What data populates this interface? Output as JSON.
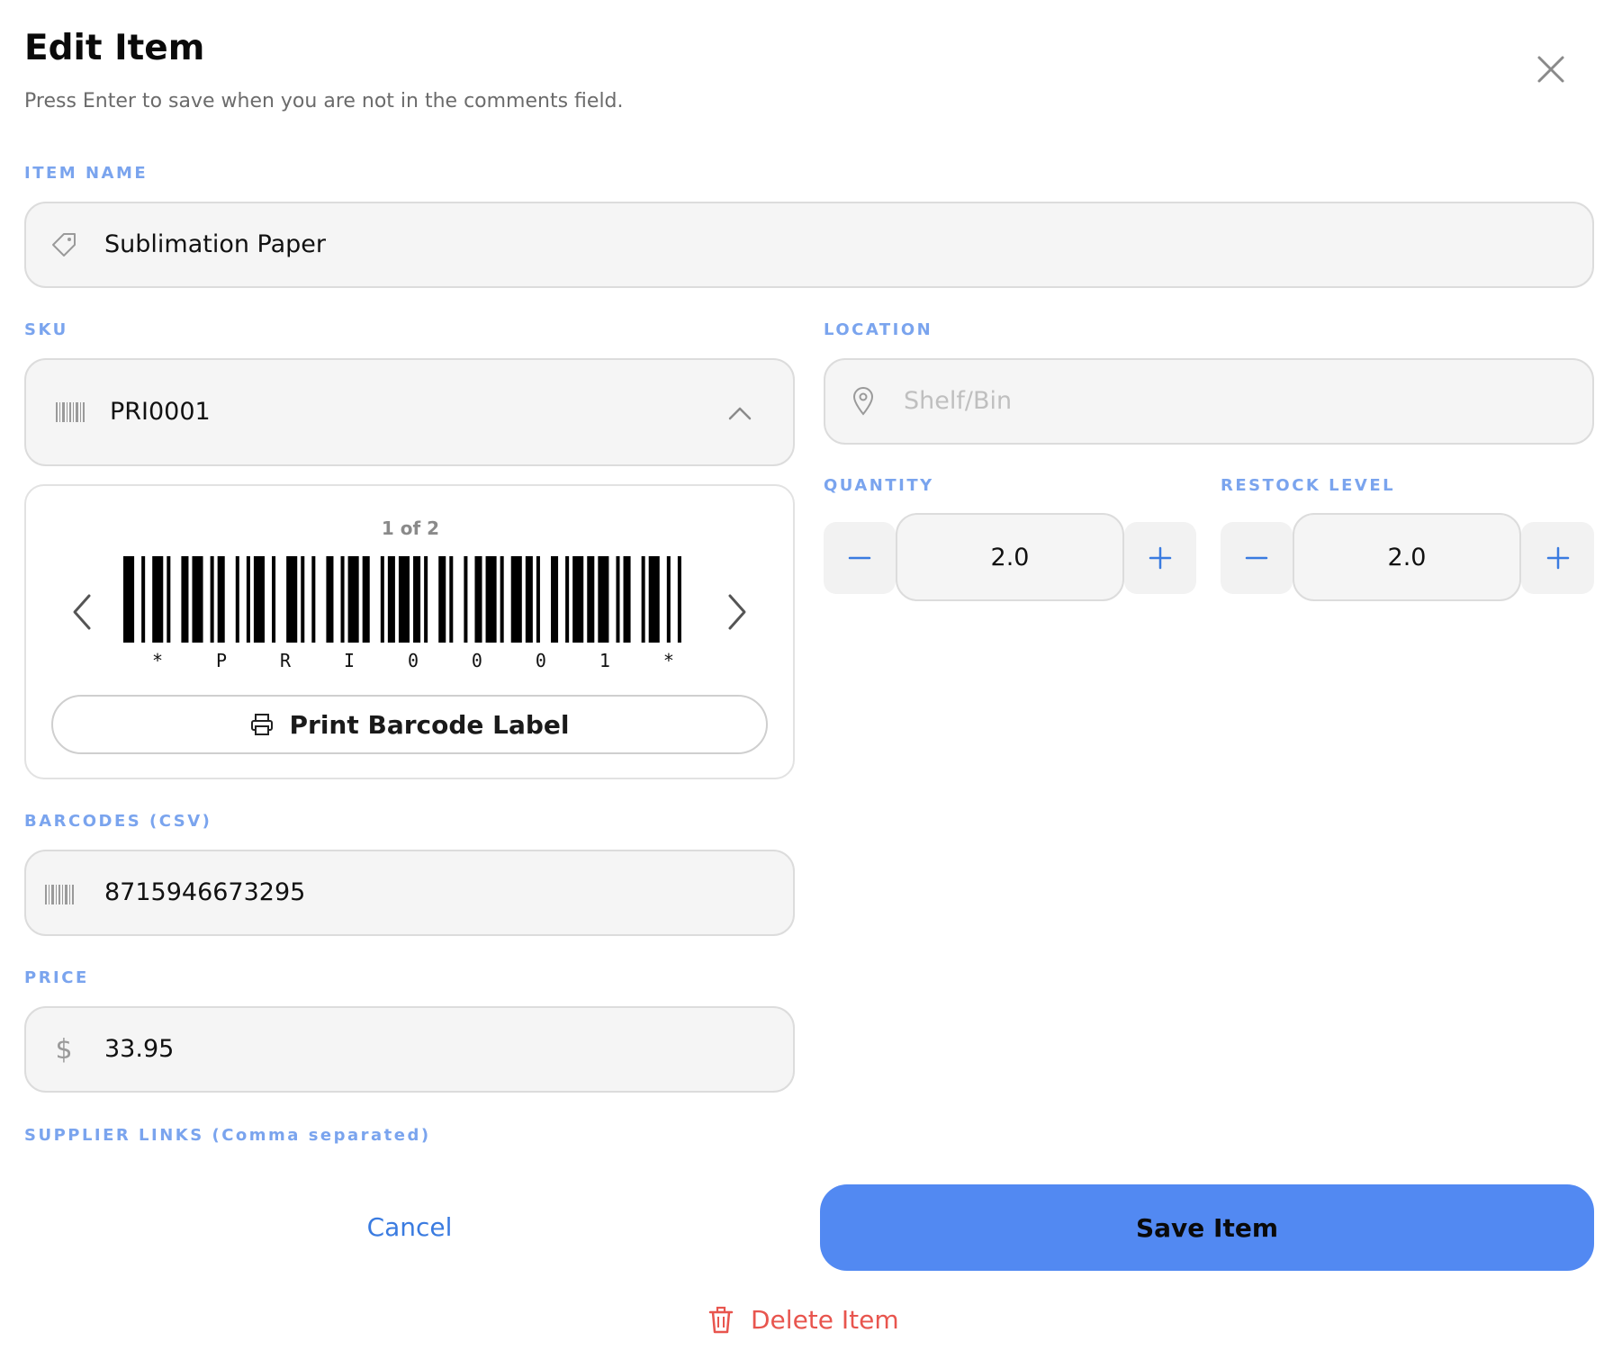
{
  "header": {
    "title": "Edit Item",
    "subtitle": "Press Enter to save when you are not in the comments field."
  },
  "icons": {
    "close": "close-icon",
    "tag": "tag-icon",
    "barcode": "barcode-icon",
    "chevron_up": "chevron-up-icon",
    "pin": "map-pin-icon",
    "prev": "chevron-left-icon",
    "next": "chevron-right-icon",
    "printer": "printer-icon",
    "minus": "minus-icon",
    "plus": "plus-icon",
    "dollar": "dollar-icon",
    "trash": "trash-icon"
  },
  "item_name": {
    "label": "ITEM NAME",
    "value": "Sublimation Paper"
  },
  "sku": {
    "label": "SKU",
    "value": "PRI0001",
    "pager": "1 of 2",
    "barcode_text": [
      "*",
      "P",
      "R",
      "I",
      "0",
      "0",
      "0",
      "1",
      "*"
    ],
    "print_label": "Print Barcode Label"
  },
  "location": {
    "label": "LOCATION",
    "placeholder": "Shelf/Bin",
    "value": ""
  },
  "quantity": {
    "label": "QUANTITY",
    "value": "2.0"
  },
  "restock": {
    "label": "RESTOCK LEVEL",
    "value": "2.0"
  },
  "barcodes": {
    "label": "BARCODES (CSV)",
    "value": "8715946673295"
  },
  "price": {
    "label": "PRICE",
    "value": "33.95"
  },
  "supplier_links": {
    "label": "SUPPLIER LINKS (Comma separated)"
  },
  "actions": {
    "cancel": "Cancel",
    "save": "Save Item",
    "delete": "Delete Item"
  },
  "colors": {
    "label": "#7aa4ee",
    "accent": "#5289f2",
    "link": "#3a7be0",
    "danger": "#e8554e"
  }
}
